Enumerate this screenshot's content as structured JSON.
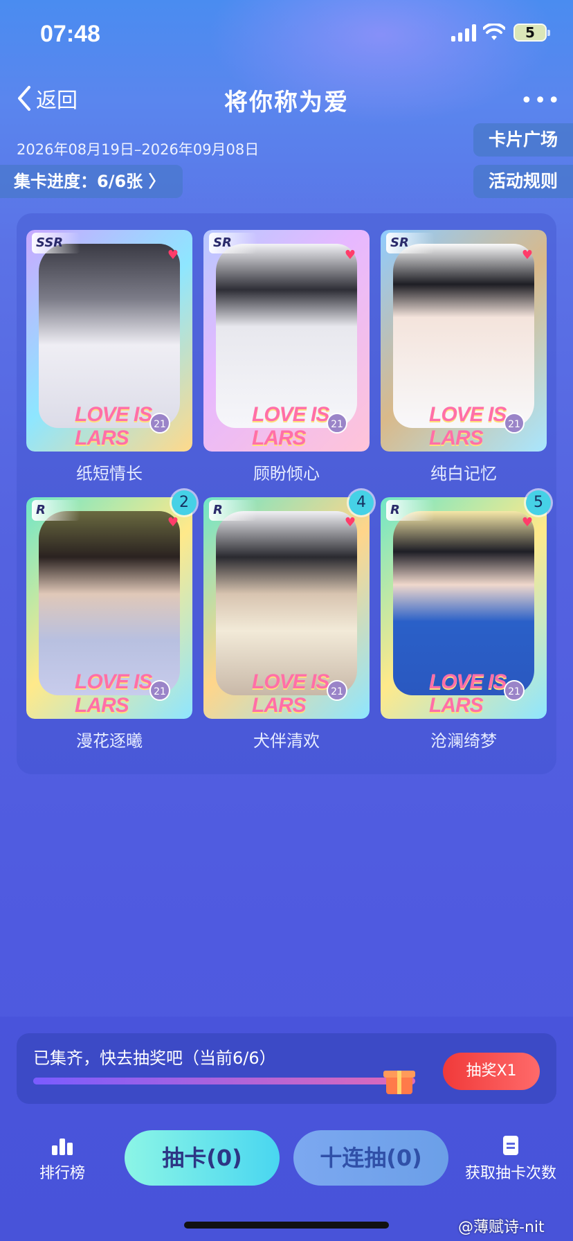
{
  "status_bar": {
    "time": "07:48",
    "battery": "5"
  },
  "nav": {
    "back_label": "返回",
    "title": "将你称为爱",
    "more": "•••"
  },
  "event": {
    "date_range": "2026年08月19日–2026年09月08日",
    "progress_label": "集卡进度：6/6张 〉"
  },
  "side_buttons": {
    "plaza": "卡片广场",
    "rules": "活动规则"
  },
  "cards": [
    {
      "rarity": "SSR",
      "name": "纸短情长",
      "count": "",
      "logo": "LOVE IS LARS",
      "badge": "21"
    },
    {
      "rarity": "SR",
      "name": "顾盼倾心",
      "count": "",
      "logo": "LOVE IS LARS",
      "badge": "21"
    },
    {
      "rarity": "SR",
      "name": "纯白记忆",
      "count": "",
      "logo": "LOVE IS LARS",
      "badge": "21"
    },
    {
      "rarity": "R",
      "name": "漫花逐曦",
      "count": "2",
      "logo": "LOVE IS LARS",
      "badge": "21"
    },
    {
      "rarity": "R",
      "name": "犬伴清欢",
      "count": "4",
      "logo": "LOVE IS LARS",
      "badge": "21"
    },
    {
      "rarity": "R",
      "name": "沧澜绮梦",
      "count": "5",
      "logo": "LOVE IS LARS",
      "badge": "21"
    }
  ],
  "draw_panel": {
    "text": "已集齐，快去抽奖吧（当前6/6）",
    "progress": 1.0,
    "lottery_button": "抽奖X1"
  },
  "tabbar": {
    "rank": "排行榜",
    "draw": "抽卡(0)",
    "ten_draw": "十连抽(0)",
    "get_count": "获取抽卡次数"
  },
  "watermark": "@薄赋诗-nit",
  "colors": {
    "accent_cyan": "#49d6f0",
    "lottery_red": "#f03a3a",
    "badge_cyan": "#46d1e6"
  }
}
